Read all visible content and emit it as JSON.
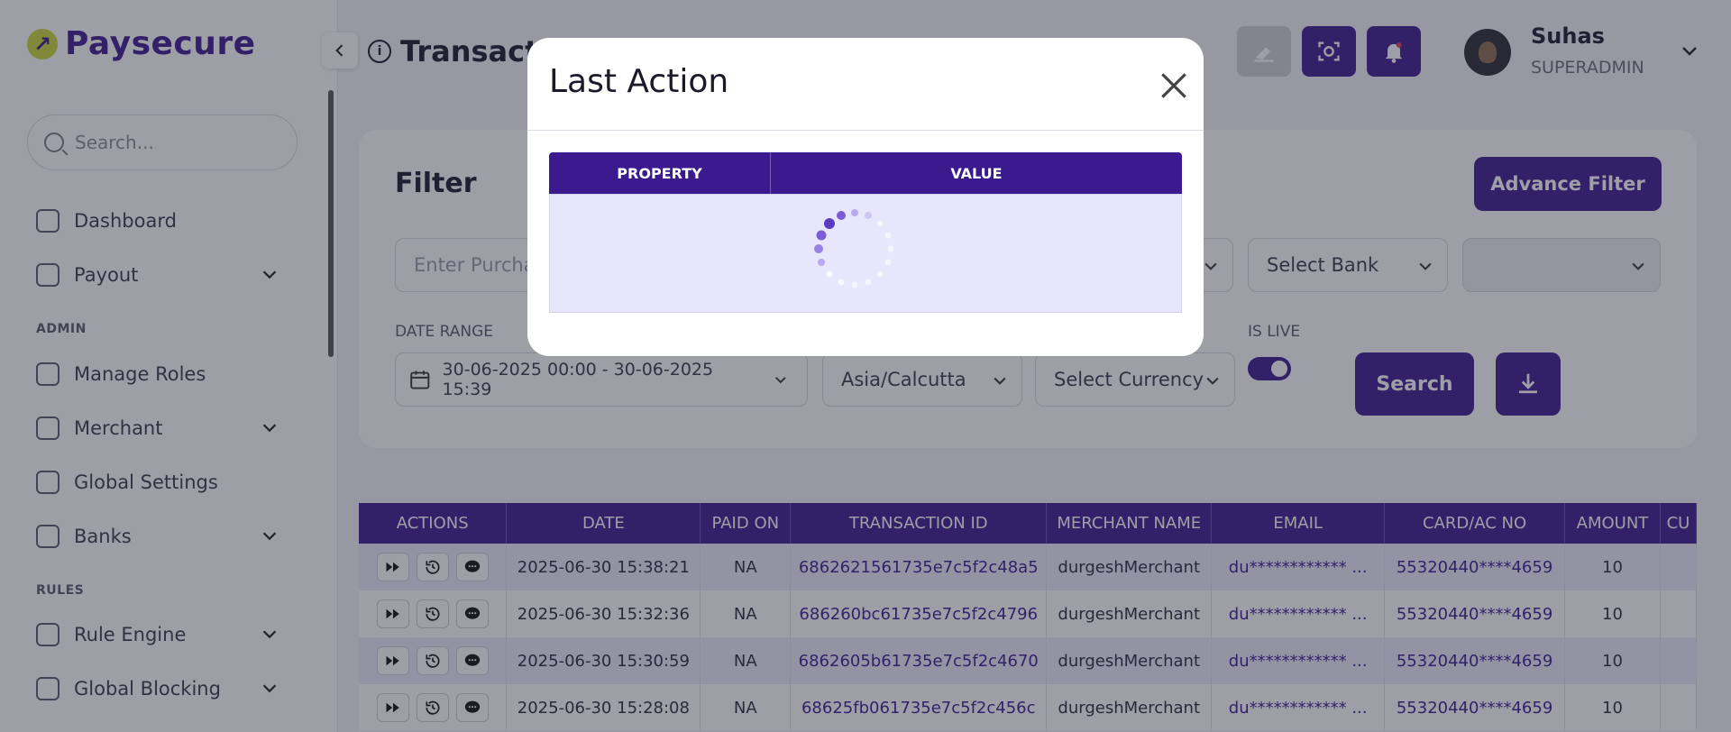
{
  "app": {
    "logo_text": "Paysecure",
    "page_title": "Transactions"
  },
  "sidebar": {
    "search_placeholder": "Search...",
    "items": [
      {
        "label": "Dashboard",
        "expandable": false
      },
      {
        "label": "Payout",
        "expandable": true
      },
      {
        "label": "Manage Roles",
        "expandable": false
      },
      {
        "label": "Merchant",
        "expandable": true
      },
      {
        "label": "Global Settings",
        "expandable": false
      },
      {
        "label": "Banks",
        "expandable": true
      },
      {
        "label": "Rule Engine",
        "expandable": true
      },
      {
        "label": "Global Blocking",
        "expandable": true
      }
    ],
    "sections": {
      "admin": "ADMIN",
      "rules": "RULES"
    }
  },
  "header": {
    "user_name": "Suhas",
    "user_role": "SUPERADMIN",
    "icons": [
      "eraser-icon",
      "scan-icon",
      "bell-icon"
    ]
  },
  "filter": {
    "title": "Filter",
    "advance_filter_label": "Advance Filter",
    "purchase_placeholder": "Enter Purchase",
    "select_bank": "Select Bank",
    "date_range_label": "DATE RANGE",
    "date_range_value": "30-06-2025 00:00 - 30-06-2025 15:39",
    "timezone": "Asia/Calcutta",
    "currency": "Select Currency",
    "is_live_label": "IS LIVE",
    "is_live": true,
    "search_label": "Search"
  },
  "table": {
    "columns": [
      "ACTIONS",
      "DATE",
      "PAID ON",
      "TRANSACTION ID",
      "MERCHANT NAME",
      "EMAIL",
      "CARD/AC NO",
      "AMOUNT",
      "CU"
    ],
    "rows": [
      {
        "date": "2025-06-30 15:38:21",
        "paid_on": "NA",
        "txn_id": "6862621561735e7c5f2c48a5",
        "merchant": "durgeshMerchant",
        "email": "du************ ...",
        "card": "55320440****4659",
        "amount": "10"
      },
      {
        "date": "2025-06-30 15:32:36",
        "paid_on": "NA",
        "txn_id": "686260bc61735e7c5f2c4796",
        "merchant": "durgeshMerchant",
        "email": "du************ ...",
        "card": "55320440****4659",
        "amount": "10"
      },
      {
        "date": "2025-06-30 15:30:59",
        "paid_on": "NA",
        "txn_id": "6862605b61735e7c5f2c4670",
        "merchant": "durgeshMerchant",
        "email": "du************ ...",
        "card": "55320440****4659",
        "amount": "10"
      },
      {
        "date": "2025-06-30 15:28:08",
        "paid_on": "NA",
        "txn_id": "68625fb061735e7c5f2c456c",
        "merchant": "durgeshMerchant",
        "email": "du************ ...",
        "card": "55320440****4659",
        "amount": "10"
      }
    ]
  },
  "modal": {
    "title": "Last Action",
    "col_property": "PROPERTY",
    "col_value": "VALUE",
    "loading": true
  },
  "colors": {
    "brand": "#3b1a8e",
    "logo_accent": "#c9d83a",
    "row_alt": "#ecebfa"
  }
}
